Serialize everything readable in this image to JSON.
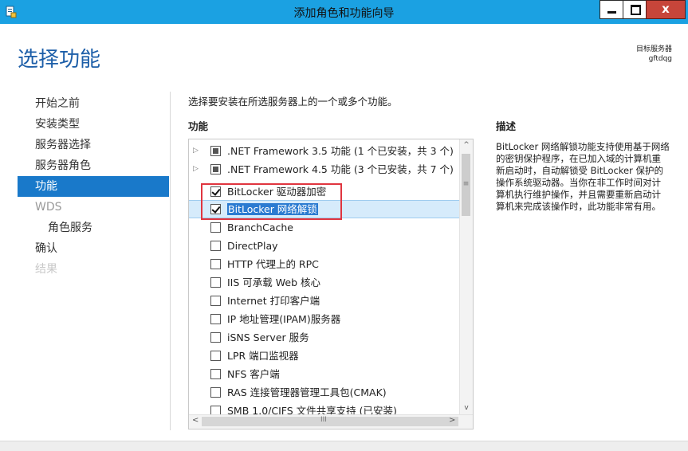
{
  "window": {
    "title": "添加角色和功能向导",
    "close_glyph": "x"
  },
  "page": {
    "heading": "选择功能",
    "target_server_label": "目标服务器",
    "target_server_name": "gftdqg"
  },
  "nav": {
    "items": [
      {
        "label": "开始之前",
        "state": "normal"
      },
      {
        "label": "安装类型",
        "state": "normal"
      },
      {
        "label": "服务器选择",
        "state": "normal"
      },
      {
        "label": "服务器角色",
        "state": "normal"
      },
      {
        "label": "功能",
        "state": "active"
      },
      {
        "label": "WDS",
        "state": "dim"
      },
      {
        "label": "角色服务",
        "state": "sub"
      },
      {
        "label": "确认",
        "state": "normal"
      },
      {
        "label": "结果",
        "state": "disabled"
      }
    ]
  },
  "main": {
    "instruction": "选择要安装在所选服务器上的一个或多个功能。",
    "features_header": "功能",
    "features": [
      {
        "label": ".NET Framework 3.5 功能 (1 个已安装，共 3 个)",
        "state": "partial",
        "expandable": true
      },
      {
        "label": ".NET Framework 4.5 功能 (3 个已安装，共 7 个)",
        "state": "partial",
        "expandable": true
      },
      {
        "label": "BitLocker 驱动器加密",
        "state": "checked"
      },
      {
        "label": "BitLocker 网络解锁",
        "state": "checked",
        "selected": true
      },
      {
        "label": "BranchCache",
        "state": "unchecked"
      },
      {
        "label": "DirectPlay",
        "state": "unchecked"
      },
      {
        "label": "HTTP 代理上的 RPC",
        "state": "unchecked"
      },
      {
        "label": "IIS 可承载 Web 核心",
        "state": "unchecked"
      },
      {
        "label": "Internet 打印客户端",
        "state": "unchecked"
      },
      {
        "label": "IP 地址管理(IPAM)服务器",
        "state": "unchecked"
      },
      {
        "label": "iSNS Server 服务",
        "state": "unchecked"
      },
      {
        "label": "LPR 端口监视器",
        "state": "unchecked"
      },
      {
        "label": "NFS 客户端",
        "state": "unchecked"
      },
      {
        "label": "RAS 连接管理器管理工具包(CMAK)",
        "state": "unchecked"
      },
      {
        "label": "SMB 1.0/CIFS 文件共享支持 (已安装)",
        "state": "unchecked"
      }
    ]
  },
  "description": {
    "header": "描述",
    "text": "BitLocker 网络解锁功能支持使用基于网络的密钥保护程序，在已加入域的计算机重新启动时，自动解锁受 BitLocker 保护的操作系统驱动器。当你在非工作时间对计算机执行维护操作，并且需要重新启动计算机来完成该操作时，此功能非常有用。"
  },
  "scrollbar": {
    "up": "^",
    "down": "v",
    "left": "<",
    "right": ">",
    "vgrip": "≡",
    "hgrip": "III"
  },
  "colors": {
    "titlebar": "#1ba1e2",
    "accent": "#1979ca",
    "highlight_box": "#e0353f"
  }
}
